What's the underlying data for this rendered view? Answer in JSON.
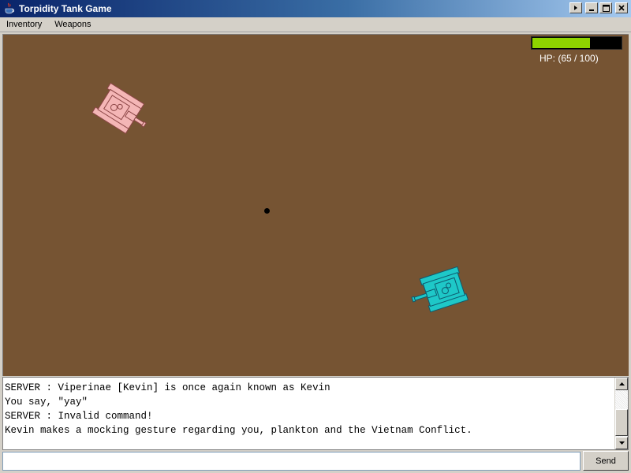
{
  "window": {
    "title": "Torpidity Tank Game",
    "icon": "java-cup-icon",
    "controls": [
      "extra-arrow-icon",
      "minimize-icon",
      "maximize-icon",
      "close-icon"
    ]
  },
  "menu": {
    "items": [
      {
        "label": "Inventory"
      },
      {
        "label": "Weapons"
      }
    ]
  },
  "game": {
    "background_color": "#765433",
    "hp": {
      "current": 65,
      "max": 100,
      "label": "HP: (65 / 100)",
      "fill_color": "#8ed300"
    },
    "tanks": [
      {
        "name": "pink-tank",
        "color": "#f4b6b6",
        "outline": "#8c4646"
      },
      {
        "name": "cyan-tank",
        "color": "#1ec8c8",
        "outline": "#0e5a6e"
      }
    ]
  },
  "chat": {
    "lines": [
      "SERVER : Viperinae [Kevin] is once again known as Kevin",
      "You say, \"yay\"",
      "SERVER : Invalid command!",
      "Kevin makes a mocking gesture regarding you, plankton and the Vietnam Conflict."
    ],
    "input_value": "",
    "send_label": "Send"
  }
}
